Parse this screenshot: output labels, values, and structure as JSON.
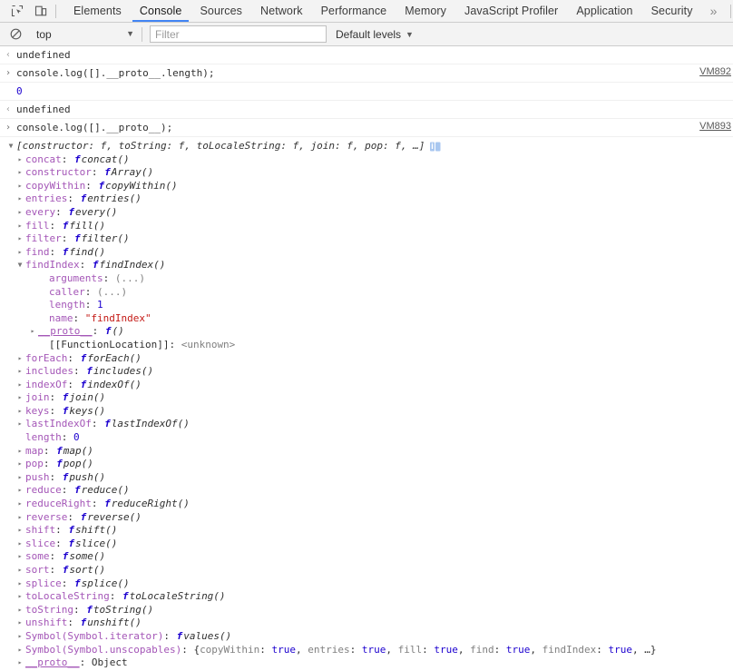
{
  "tabstrip": {
    "icons": [
      {
        "name": "inspect-element-icon",
        "label": "Inspect element"
      },
      {
        "name": "device-toolbar-icon",
        "label": "Toggle device toolbar"
      }
    ],
    "tabs": [
      {
        "label": "Elements",
        "active": false
      },
      {
        "label": "Console",
        "active": true
      },
      {
        "label": "Sources",
        "active": false
      },
      {
        "label": "Network",
        "active": false
      },
      {
        "label": "Performance",
        "active": false
      },
      {
        "label": "Memory",
        "active": false
      },
      {
        "label": "JavaScript Profiler",
        "active": false
      },
      {
        "label": "Application",
        "active": false
      },
      {
        "label": "Security",
        "active": false
      }
    ],
    "more_label": "»"
  },
  "filterbar": {
    "clear_icon": "clear-console-icon",
    "context": "top",
    "context_caret": "▼",
    "filter_placeholder": "Filter",
    "filter_value": "",
    "levels_label": "Default levels",
    "levels_caret": "▼"
  },
  "colors": {
    "accent": "#4285f4",
    "property": "#a456b7",
    "keyword": "#1c00cf",
    "string": "#c41a16",
    "toolbar_bg": "#f3f3f3"
  },
  "messages": [
    {
      "type": "result",
      "arrow": "‹",
      "text": "undefined",
      "vm": ""
    },
    {
      "type": "input",
      "arrow": "›",
      "text": "console.log([].__proto__.length);",
      "vm": "VM892"
    },
    {
      "type": "output",
      "arrow": "",
      "text": "0",
      "vm": ""
    },
    {
      "type": "result",
      "arrow": "‹",
      "text": "undefined",
      "vm": ""
    },
    {
      "type": "input",
      "arrow": "›",
      "text": "console.log([].__proto__);",
      "vm": "VM893"
    }
  ],
  "object_tree": {
    "header": "[constructor: f, toString: f, toLocaleString: f, join: f, pop: f, …]",
    "header_triangle": "▼",
    "info_icon": "info-badge-icon",
    "properties": [
      {
        "tri": "▸",
        "name": "concat",
        "kind": "fn",
        "fn": "concat()",
        "indent": 1
      },
      {
        "tri": "▸",
        "name": "constructor",
        "kind": "fn",
        "fn": "Array()",
        "indent": 1
      },
      {
        "tri": "▸",
        "name": "copyWithin",
        "kind": "fn",
        "fn": "copyWithin()",
        "indent": 1
      },
      {
        "tri": "▸",
        "name": "entries",
        "kind": "fn",
        "fn": "entries()",
        "indent": 1
      },
      {
        "tri": "▸",
        "name": "every",
        "kind": "fn",
        "fn": "every()",
        "indent": 1
      },
      {
        "tri": "▸",
        "name": "fill",
        "kind": "fn",
        "fn": "fill()",
        "indent": 1
      },
      {
        "tri": "▸",
        "name": "filter",
        "kind": "fn",
        "fn": "filter()",
        "indent": 1
      },
      {
        "tri": "▸",
        "name": "find",
        "kind": "fn",
        "fn": "find()",
        "indent": 1
      },
      {
        "tri": "▼",
        "name": "findIndex",
        "kind": "fn",
        "fn": "findIndex()",
        "indent": 1
      },
      {
        "tri": "",
        "name": "arguments",
        "kind": "gray",
        "value": "(...)",
        "indent": 2
      },
      {
        "tri": "",
        "name": "caller",
        "kind": "gray",
        "value": "(...)",
        "indent": 2
      },
      {
        "tri": "",
        "name": "length",
        "kind": "num",
        "value": "1",
        "indent": 2
      },
      {
        "tri": "",
        "name": "name",
        "kind": "str",
        "value": "\"findIndex\"",
        "indent": 2
      },
      {
        "tri": "▸",
        "name": "__proto__",
        "kind": "fn-anon",
        "fn": "()",
        "indent": 2,
        "proto": true
      },
      {
        "tri": "",
        "name": "[[FunctionLocation]]",
        "kind": "internal",
        "value": "<unknown>",
        "indent": 2
      },
      {
        "tri": "▸",
        "name": "forEach",
        "kind": "fn",
        "fn": "forEach()",
        "indent": 1
      },
      {
        "tri": "▸",
        "name": "includes",
        "kind": "fn",
        "fn": "includes()",
        "indent": 1
      },
      {
        "tri": "▸",
        "name": "indexOf",
        "kind": "fn",
        "fn": "indexOf()",
        "indent": 1
      },
      {
        "tri": "▸",
        "name": "join",
        "kind": "fn",
        "fn": "join()",
        "indent": 1
      },
      {
        "tri": "▸",
        "name": "keys",
        "kind": "fn",
        "fn": "keys()",
        "indent": 1
      },
      {
        "tri": "▸",
        "name": "lastIndexOf",
        "kind": "fn",
        "fn": "lastIndexOf()",
        "indent": 1
      },
      {
        "tri": "",
        "name": "length",
        "kind": "num",
        "value": "0",
        "indent": 1
      },
      {
        "tri": "▸",
        "name": "map",
        "kind": "fn",
        "fn": "map()",
        "indent": 1
      },
      {
        "tri": "▸",
        "name": "pop",
        "kind": "fn",
        "fn": "pop()",
        "indent": 1
      },
      {
        "tri": "▸",
        "name": "push",
        "kind": "fn",
        "fn": "push()",
        "indent": 1
      },
      {
        "tri": "▸",
        "name": "reduce",
        "kind": "fn",
        "fn": "reduce()",
        "indent": 1
      },
      {
        "tri": "▸",
        "name": "reduceRight",
        "kind": "fn",
        "fn": "reduceRight()",
        "indent": 1
      },
      {
        "tri": "▸",
        "name": "reverse",
        "kind": "fn",
        "fn": "reverse()",
        "indent": 1
      },
      {
        "tri": "▸",
        "name": "shift",
        "kind": "fn",
        "fn": "shift()",
        "indent": 1
      },
      {
        "tri": "▸",
        "name": "slice",
        "kind": "fn",
        "fn": "slice()",
        "indent": 1
      },
      {
        "tri": "▸",
        "name": "some",
        "kind": "fn",
        "fn": "some()",
        "indent": 1
      },
      {
        "tri": "▸",
        "name": "sort",
        "kind": "fn",
        "fn": "sort()",
        "indent": 1
      },
      {
        "tri": "▸",
        "name": "splice",
        "kind": "fn",
        "fn": "splice()",
        "indent": 1
      },
      {
        "tri": "▸",
        "name": "toLocaleString",
        "kind": "fn",
        "fn": "toLocaleString()",
        "indent": 1
      },
      {
        "tri": "▸",
        "name": "toString",
        "kind": "fn",
        "fn": "toString()",
        "indent": 1
      },
      {
        "tri": "▸",
        "name": "unshift",
        "kind": "fn",
        "fn": "unshift()",
        "indent": 1
      },
      {
        "tri": "▸",
        "name": "Symbol(Symbol.iterator)",
        "kind": "fn",
        "fn": "values()",
        "indent": 1
      },
      {
        "tri": "▸",
        "name": "Symbol(Symbol.unscopables)",
        "kind": "unscopables",
        "indent": 1,
        "entries": [
          {
            "key": "copyWithin",
            "value": "true"
          },
          {
            "key": "entries",
            "value": "true"
          },
          {
            "key": "fill",
            "value": "true"
          },
          {
            "key": "find",
            "value": "true"
          },
          {
            "key": "findIndex",
            "value": "true"
          }
        ],
        "ellipsis": "…"
      },
      {
        "tri": "▸",
        "name": "__proto__",
        "kind": "plain",
        "value": "Object",
        "indent": 1,
        "proto": true
      }
    ]
  }
}
